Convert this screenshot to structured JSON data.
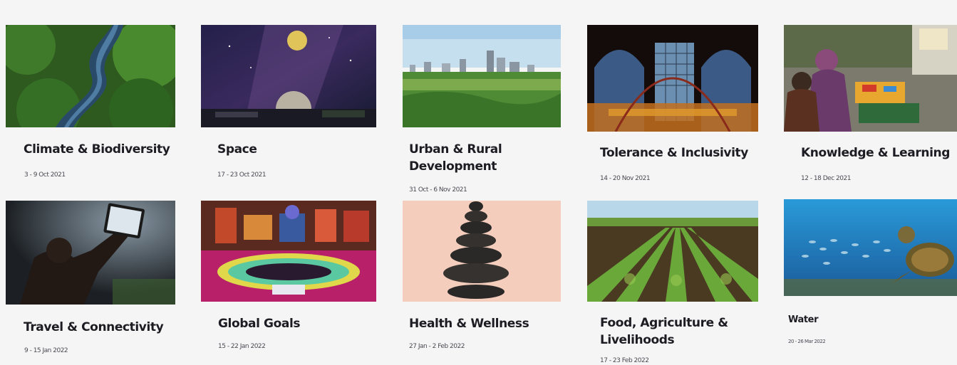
{
  "themes": [
    {
      "title": "Climate & Biodiversity",
      "date": "3 - 9 Oct 2021",
      "image": "rainforest-river-photo"
    },
    {
      "title": "Space",
      "date": "17 - 23 Oct 2021",
      "image": "night-sky-dome-photo"
    },
    {
      "title": "Urban & Rural Development",
      "date": "31 Oct - 6 Nov 2021",
      "image": "city-skyline-greenery-photo"
    },
    {
      "title": "Tolerance & Inclusivity",
      "date": "14 - 20 Nov 2021",
      "image": "arches-building-overlay-photo"
    },
    {
      "title": "Knowledge & Learning",
      "date": "12 - 18 Dec 2021",
      "image": "children-studying-outdoors-photo"
    },
    {
      "title": "Travel & Connectivity",
      "date": "9 - 15 Jan 2022",
      "image": "person-holding-tablet-photo"
    },
    {
      "title": "Global Goals",
      "date": "15 - 22 Jan 2022",
      "image": "exhibition-hall-photo"
    },
    {
      "title": "Health & Wellness",
      "date": "27 Jan - 2 Feb 2022",
      "image": "stacked-stones-photo"
    },
    {
      "title": "Food, Agriculture & Livelihoods",
      "date": "17 - 23 Feb 2022",
      "image": "crop-field-rows-photo"
    },
    {
      "title": "Water",
      "date": "20 - 26 Mar 2022",
      "image": "sea-turtle-fish-photo"
    }
  ]
}
